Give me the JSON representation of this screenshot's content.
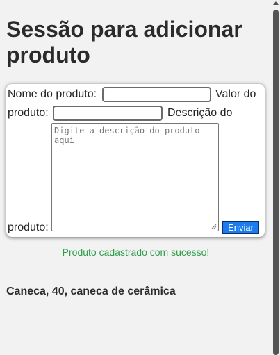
{
  "page": {
    "title": "Sessão para adicionar produto"
  },
  "form": {
    "name_label": "Nome do produto:",
    "name_value": "",
    "value_label_part1": "Valor do",
    "value_label_part2": "produto:",
    "value_value": "",
    "description_label_part1": "Descrição do",
    "description_label_part2": "produto:",
    "description_placeholder": "Digite a descrição do produto aqui",
    "submit_label": "Enviar"
  },
  "status": {
    "message": "Produto cadastrado com sucesso!",
    "color": "#2e9e4b"
  },
  "products": [
    {
      "text": "Caneca, 40, caneca de cerâmica"
    }
  ],
  "colors": {
    "button": "#1a7cf0",
    "background": "#f2f2f2"
  }
}
